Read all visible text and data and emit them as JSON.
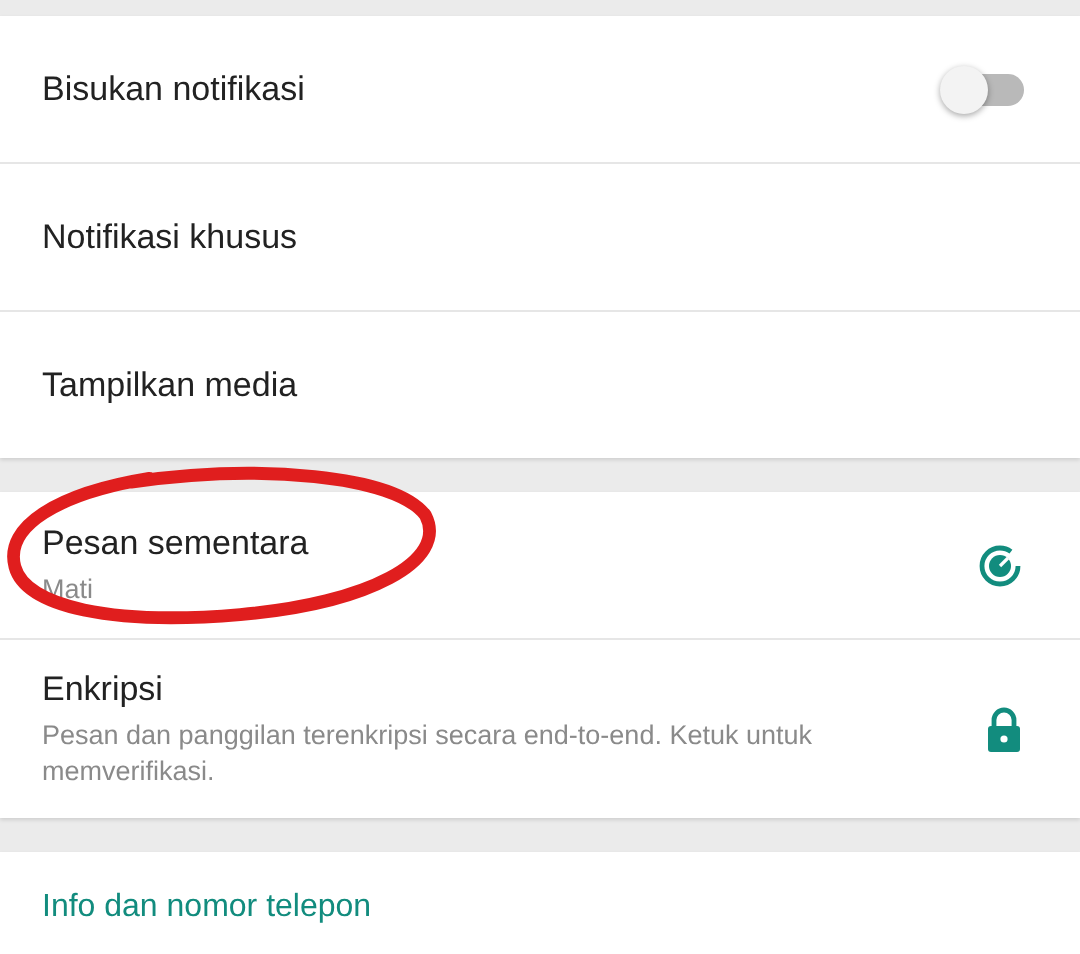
{
  "sections": [
    {
      "items": [
        {
          "kind": "toggle",
          "title": "Bisukan notifikasi",
          "on": false
        },
        {
          "kind": "plain",
          "title": "Notifikasi khusus"
        },
        {
          "kind": "plain",
          "title": "Tampilkan media"
        }
      ]
    },
    {
      "items": [
        {
          "kind": "timer",
          "title": "Pesan sementara",
          "subtitle": "Mati",
          "circled": true
        },
        {
          "kind": "lock",
          "title": "Enkripsi",
          "subtitle": "Pesan dan panggilan terenkripsi secara end-to-end. Ketuk untuk memverifikasi."
        }
      ]
    },
    {
      "items": [
        {
          "kind": "link",
          "title": "Info dan nomor telepon"
        }
      ]
    }
  ]
}
